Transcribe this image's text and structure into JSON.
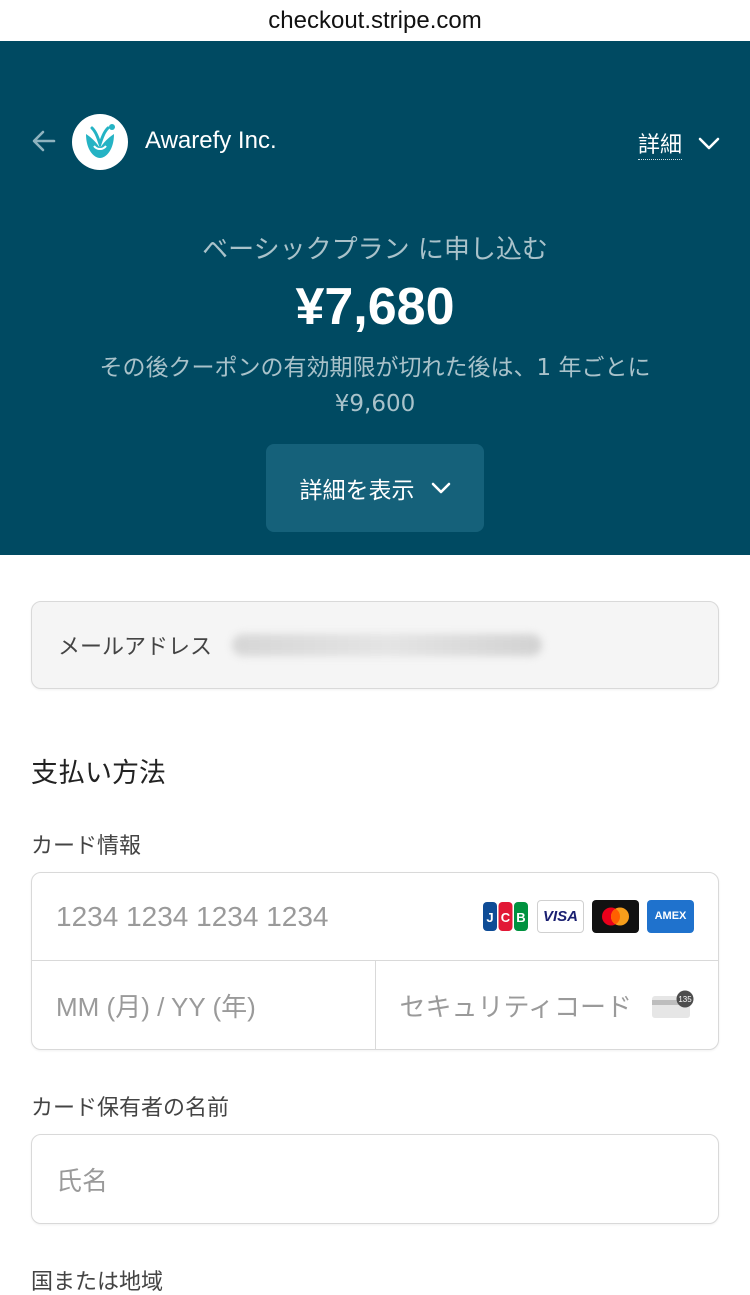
{
  "browser": {
    "url": "checkout.stripe.com"
  },
  "header": {
    "company_name": "Awarefy Inc.",
    "details_label": "詳細",
    "plan_title": "ベーシックプラン に申し込む",
    "price": "¥7,680",
    "renewal_line1": "その後クーポンの有効期限が切れた後は、1 年ごとに",
    "renewal_line2": "¥9,600",
    "show_details_label": "詳細を表示",
    "background_color": "#004a62"
  },
  "form": {
    "email_label": "メールアドレス",
    "payment_method_title": "支払い方法",
    "card_info_label": "カード情報",
    "card_number_placeholder": "1234 1234 1234 1234",
    "expiry_placeholder": "MM (月) / YY (年)",
    "cvc_placeholder": "セキュリティコード",
    "cvc_icon_text": "135",
    "card_brands": {
      "jcb": "JCB",
      "visa": "VISA",
      "amex": "AMEX"
    },
    "cardholder_label": "カード保有者の名前",
    "cardholder_placeholder": "氏名",
    "country_label": "国または地域"
  },
  "icons": [
    "back-arrow-icon",
    "awarefy-logo-icon",
    "chevron-down-icon",
    "jcb-icon",
    "visa-icon",
    "mastercard-icon",
    "amex-icon",
    "cvc-card-icon"
  ]
}
